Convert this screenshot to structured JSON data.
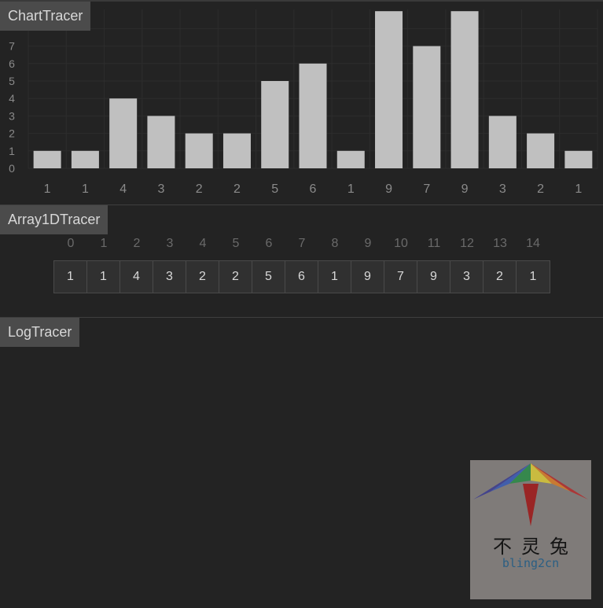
{
  "panels": {
    "chart_title": "ChartTracer",
    "array_title": "Array1DTracer",
    "log_title": "LogTracer"
  },
  "chart_data": {
    "type": "bar",
    "categories": [
      "1",
      "1",
      "4",
      "3",
      "2",
      "2",
      "5",
      "6",
      "1",
      "9",
      "7",
      "9",
      "3",
      "2",
      "1"
    ],
    "values": [
      1,
      1,
      4,
      3,
      2,
      2,
      5,
      6,
      1,
      9,
      7,
      9,
      3,
      2,
      1
    ],
    "ylim": [
      0,
      8
    ],
    "yticks": [
      0,
      1,
      2,
      3,
      4,
      5,
      6,
      7
    ],
    "grid": true,
    "title": "",
    "xlabel": "",
    "ylabel": "",
    "colors": {
      "bar": "#c0c0c0",
      "grid": "#2d2d2d",
      "tick_label": "#8a8a8a",
      "background": "#232323"
    }
  },
  "array": {
    "indices": [
      "0",
      "1",
      "2",
      "3",
      "4",
      "5",
      "6",
      "7",
      "8",
      "9",
      "10",
      "11",
      "12",
      "13",
      "14"
    ],
    "values": [
      "1",
      "1",
      "4",
      "3",
      "2",
      "2",
      "5",
      "6",
      "1",
      "9",
      "7",
      "9",
      "3",
      "2",
      "1"
    ]
  },
  "log": {
    "entries": []
  },
  "watermark": {
    "chars": "不灵兔",
    "text": "bling2cn",
    "kite_colors": [
      "#3e3e8e",
      "#3b5bb0",
      "#2f8a48",
      "#d1c23a",
      "#d07a2a",
      "#b03030",
      "#8a2a2a"
    ]
  }
}
